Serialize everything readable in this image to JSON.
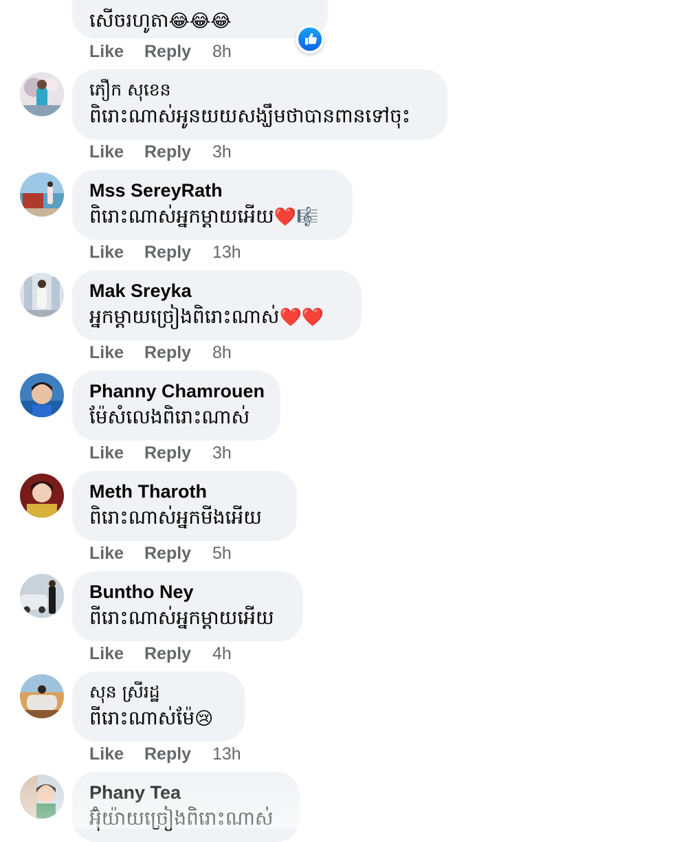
{
  "top_comment": {
    "text": "សើចរហូតា",
    "emoji": "😂😂😂",
    "like_label": "Like",
    "reply_label": "Reply",
    "time": "8h"
  },
  "comments": [
    {
      "name": "ភឿក សុខេន",
      "text": "ពិរោះណាស់អូនយយសង្ឃឹមថាបានពានទៅចុះ",
      "emoji": "",
      "like_label": "Like",
      "reply_label": "Reply",
      "time": "3h"
    },
    {
      "name": "Mss SereyRath",
      "text": "ពិរោះណាស់អ្នកម្តាយអើយ",
      "emoji": "❤️🎼",
      "like_label": "Like",
      "reply_label": "Reply",
      "time": "13h"
    },
    {
      "name": "Mak Sreyka",
      "text": "អ្នកម្តាយច្រៀងពិរោះណាស់",
      "emoji": "❤️❤️",
      "like_label": "Like",
      "reply_label": "Reply",
      "time": "8h"
    },
    {
      "name": "Phanny Chamrouen",
      "text": "ម៉ែសំលេងពិរោះណាស់",
      "emoji": "",
      "like_label": "Like",
      "reply_label": "Reply",
      "time": "3h"
    },
    {
      "name": "Meth Tharoth",
      "text": "ពិរោះណាស់អ្នកមីងអើយ",
      "emoji": "",
      "like_label": "Like",
      "reply_label": "Reply",
      "time": "5h"
    },
    {
      "name": "Buntho Ney",
      "text": "ពីរោះណាស់អ្នកម្តាយអើយ",
      "emoji": "",
      "like_label": "Like",
      "reply_label": "Reply",
      "time": "4h"
    },
    {
      "name": "សុន ស្រីរដ្ឋ",
      "text": "ពីរោះណាស់ម៉ែ",
      "emoji": "😢",
      "like_label": "Like",
      "reply_label": "Reply",
      "time": "13h"
    },
    {
      "name": "Phany Tea",
      "text": "អ៊ុំយ៉ាយច្រៀងពិរោះណាស់",
      "emoji": ""
    }
  ],
  "colors": {
    "bubble": "#f0f2f5",
    "meta": "#65676b",
    "text": "#050505",
    "like_blue": "#1877f2"
  },
  "icons": {
    "reaction": "like-thumb-icon"
  }
}
